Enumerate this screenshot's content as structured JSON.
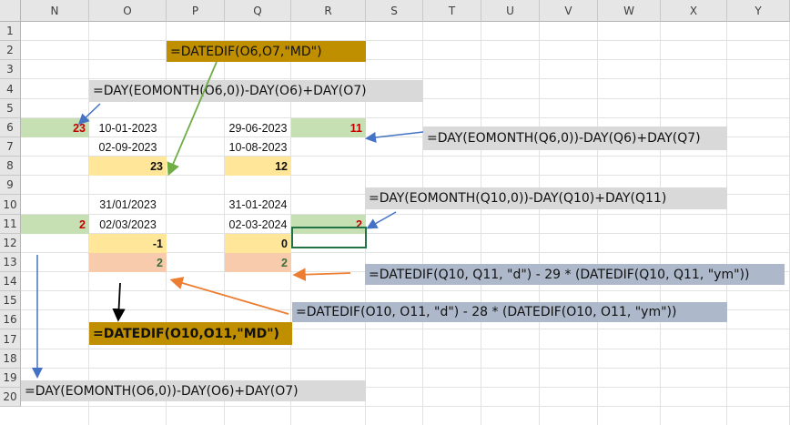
{
  "columns": [
    "N",
    "O",
    "P",
    "Q",
    "R",
    "S",
    "T",
    "U",
    "V",
    "W",
    "X",
    "Y"
  ],
  "rows": [
    "1",
    "2",
    "3",
    "4",
    "5",
    "6",
    "7",
    "8",
    "9",
    "10",
    "11",
    "12",
    "13",
    "14",
    "15",
    "16",
    "17",
    "18",
    "19",
    "20"
  ],
  "colors": {
    "green_fill": "#c6e0b4",
    "yellow_fill": "#ffe699",
    "peach_fill": "#f8cbad",
    "gray_fill": "#d9d9d9",
    "blue_fill": "#adb9ca",
    "gold_fill": "#bf8f00",
    "red_text": "#c00000",
    "arrow_blue": "#4472c4",
    "arrow_green": "#70ad47",
    "arrow_orange": "#ed7d31",
    "arrow_black": "#000000",
    "selection": "#217346"
  },
  "cells": {
    "N6": "23",
    "O6": "10-01-2023",
    "Q6": "29-06-2023",
    "R6": "11",
    "O7": "02-09-2023",
    "Q7": "10-08-2023",
    "O8": "23",
    "Q8": "12",
    "O10": "31/01/2023",
    "Q10": "31-01-2024",
    "N11": "2",
    "O11": "02/03/2023",
    "Q11": "02-03-2024",
    "R11": "2",
    "O12": "-1",
    "Q12": "0",
    "O13": "2",
    "Q13": "2"
  },
  "formulas": {
    "p2": "=DATEDIF(O6,O7,\"MD\")",
    "o4": "=DAY(EOMONTH(O6,0))-DAY(O6)+DAY(O7)",
    "s6": "=DAY(EOMONTH(Q6,0))-DAY(Q6)+DAY(Q7)",
    "s9": "=DAY(EOMONTH(Q10,0))-DAY(Q10)+DAY(Q11)",
    "s13": "=DATEDIF(Q10, Q11, \"d\") - 29 * (DATEDIF(Q10, Q11, \"ym\"))",
    "r15": "=DATEDIF(O10, O11, \"d\") - 28 * (DATEDIF(O10, O11, \"ym\"))",
    "o16": "=DATEDIF(O10,O11,\"MD\")",
    "n19": "=DAY(EOMONTH(O6,0))-DAY(O6)+DAY(O7)"
  }
}
